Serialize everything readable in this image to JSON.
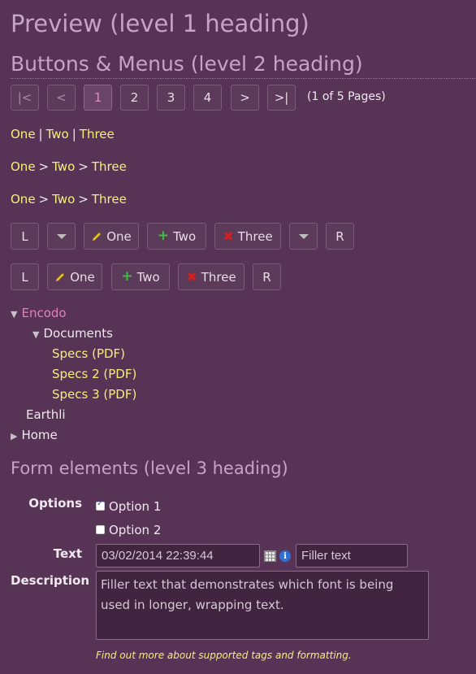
{
  "headings": {
    "h1": "Preview (level 1 heading)",
    "h2": "Buttons & Menus (level 2 heading)",
    "h3": "Form elements (level 3 heading)"
  },
  "pager": {
    "first": "|<",
    "prev": "<",
    "pages": [
      "1",
      "2",
      "3",
      "4"
    ],
    "active_page": "1",
    "next": ">",
    "last": ">|",
    "info": "(1 of 5 Pages)"
  },
  "breadcrumbs": {
    "pipe": {
      "items": [
        "One",
        "Two",
        "Three"
      ],
      "sep": "|"
    },
    "arrow1": {
      "items": [
        "One",
        "Two",
        "Three"
      ],
      "sep": ">"
    },
    "arrow2": {
      "items": [
        "One",
        "Two",
        "Three"
      ],
      "sep": ">"
    }
  },
  "toolbar1": {
    "left": "L",
    "one": "One",
    "two": "Two",
    "three": "Three",
    "right": "R"
  },
  "toolbar2": {
    "left": "L",
    "one": "One",
    "two": "Two",
    "three": "Three",
    "right": "R"
  },
  "tree": {
    "root": "Encodo",
    "documents": "Documents",
    "specs1": "Specs (PDF)",
    "specs2": "Specs 2 (PDF)",
    "specs3": "Specs 3 (PDF)",
    "earthli": "Earthli",
    "home": "Home"
  },
  "form": {
    "options_label": "Options",
    "option1": "Option 1",
    "option1_checked": true,
    "option2": "Option 2",
    "option2_checked": false,
    "text_label": "Text",
    "date_value": "03/02/2014 22:39:44",
    "info_glyph": "i",
    "filler_value": "Filler text",
    "description_label": "Description",
    "description_value": "Filler text that demonstrates which font is being used in longer, wrapping text.",
    "note": "Find out more about supported tags and formatting."
  },
  "colors": {
    "background": "#573356",
    "heading": "#c6a4c7",
    "link": "#f5ef7a",
    "active_link": "#e084b8"
  }
}
